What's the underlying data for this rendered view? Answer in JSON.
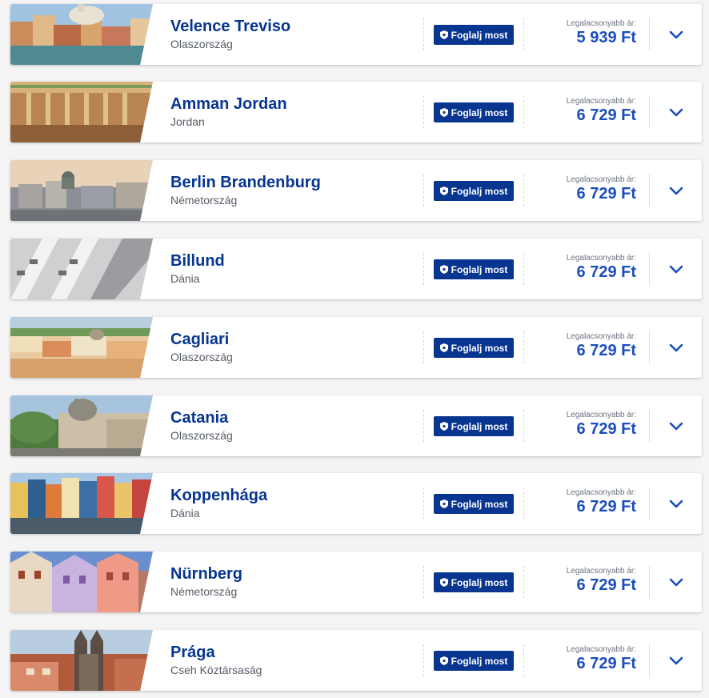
{
  "list": {
    "book_label": "Foglalj most",
    "price_label": "Legalacsonyabb ár:",
    "items": [
      {
        "city": "Velence Treviso",
        "country": "Olaszország",
        "price": "5 939 Ft",
        "image": "venice-canal-photo"
      },
      {
        "city": "Amman Jordan",
        "country": "Jordan",
        "price": "6 729 Ft",
        "image": "amman-ruins-photo"
      },
      {
        "city": "Berlin Brandenburg",
        "country": "Németország",
        "price": "6 729 Ft",
        "image": "berlin-skyline-photo"
      },
      {
        "city": "Billund",
        "country": "Dánia",
        "price": "6 729 Ft",
        "image": "billund-building-photo"
      },
      {
        "city": "Cagliari",
        "country": "Olaszország",
        "price": "6 729 Ft",
        "image": "cagliari-city-photo"
      },
      {
        "city": "Catania",
        "country": "Olaszország",
        "price": "6 729 Ft",
        "image": "catania-cathedral-photo"
      },
      {
        "city": "Koppenhága",
        "country": "Dánia",
        "price": "6 729 Ft",
        "image": "copenhagen-nyhavn-photo"
      },
      {
        "city": "Nürnberg",
        "country": "Németország",
        "price": "6 729 Ft",
        "image": "nuremberg-houses-photo"
      },
      {
        "city": "Prága",
        "country": "Cseh Köztársaság",
        "price": "6 729 Ft",
        "image": "prague-church-photo"
      }
    ]
  }
}
